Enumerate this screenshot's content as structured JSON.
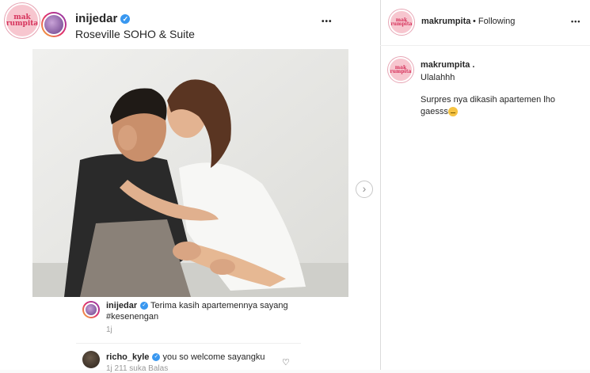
{
  "post": {
    "author": "inijedar",
    "location": "Roseville SOHO & Suite",
    "more_label": "•••",
    "next_label": "›",
    "photo_desc": "couple photo",
    "embedded_comments": [
      {
        "user": "inijedar",
        "text": "Terima kasih apartemennya sayang #kesenengan",
        "meta": "1j"
      },
      {
        "user": "richo_kyle",
        "text": "you so welcome sayangku",
        "meta": "1j  211 suka  Balas"
      }
    ]
  },
  "side": {
    "account": "makrumpita",
    "follow_state": "• Following",
    "more_label": "•••",
    "caption_user": "makrumpita .",
    "caption_line1": "Ulalahhh",
    "caption_line2": "Surpres nya dikasih apartemen lho gaesss"
  },
  "logo": {
    "line1": "mak",
    "line2": "rumpita"
  },
  "colors": {
    "verified": "#3897f0",
    "brand_pink": "#d6335c"
  }
}
